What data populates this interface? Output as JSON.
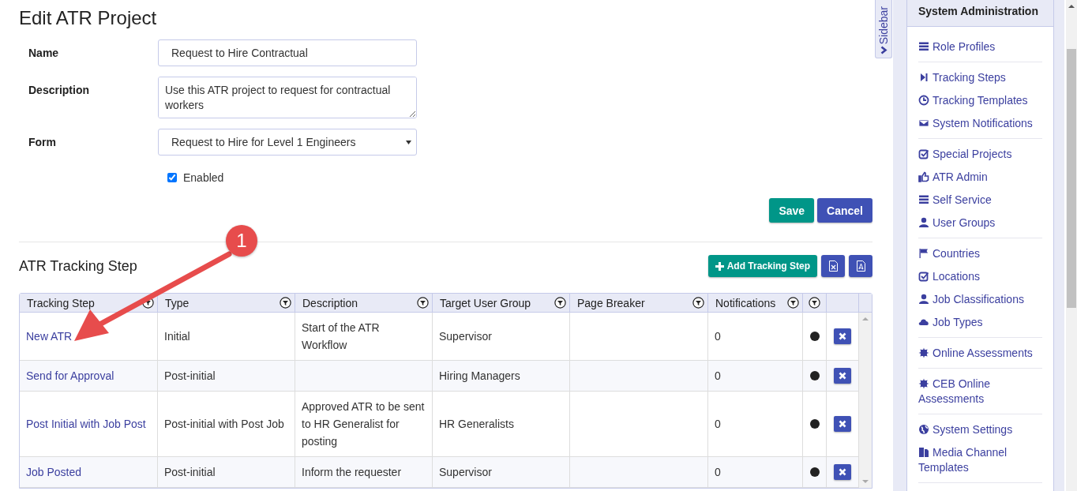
{
  "page": {
    "title": "Edit ATR Project"
  },
  "form": {
    "fields": [
      {
        "kind": "text",
        "label": "Name",
        "value": "Request to Hire Contractual"
      },
      {
        "kind": "textarea",
        "label": "Description",
        "value": "Use this ATR project to request for contractual workers"
      },
      {
        "kind": "select",
        "label": "Form",
        "value": "Request to Hire for Level 1 Engineers"
      }
    ],
    "enabled": {
      "label": "Enabled",
      "checked": true
    },
    "buttons": [
      {
        "label": "Save",
        "kind": "primary"
      },
      {
        "label": "Cancel",
        "kind": "secondary"
      }
    ]
  },
  "tracking": {
    "title": "ATR Tracking Step",
    "add_button": "Add Tracking Step",
    "columns": [
      "Tracking Step",
      "Type",
      "Description",
      "Target User Group",
      "Page Breaker",
      "Notifications"
    ],
    "rows": [
      {
        "step": "New ATR",
        "type": "Initial",
        "description": "Start of the ATR Workflow",
        "target": "Supervisor",
        "notifications": "0"
      },
      {
        "step": "Send for Approval",
        "type": "Post-initial",
        "target": "Hiring Managers",
        "notifications": "0"
      },
      {
        "step": "Post Initial with Job Post",
        "type": "Post-initial with Post Job",
        "description": "Approved ATR to be sent to HR Generalist for posting",
        "target": "HR Generalists",
        "notifications": "0"
      },
      {
        "step": "Job Posted",
        "type": "Post-initial",
        "description": "Inform the requester",
        "target": "Supervisor",
        "notifications": "0"
      }
    ]
  },
  "annotation": {
    "number": "1"
  },
  "sidebar_tab": {
    "label": "Sidebar"
  },
  "sidebar": {
    "title": "System Administration",
    "groups": [
      {
        "items": [
          {
            "label": "Role Profiles",
            "kind": "list"
          }
        ]
      },
      {
        "items": [
          {
            "label": "Tracking Steps",
            "kind": "step"
          },
          {
            "label": "Tracking Templates",
            "kind": "clock"
          },
          {
            "label": "System Notifications",
            "kind": "mail"
          }
        ]
      },
      {
        "items": [
          {
            "label": "Special Projects",
            "kind": "check"
          },
          {
            "label": "ATR Admin",
            "kind": "thumb"
          },
          {
            "label": "Self Service",
            "kind": "list"
          },
          {
            "label": "User Groups",
            "kind": "user"
          }
        ]
      },
      {
        "items": [
          {
            "label": "Countries",
            "kind": "flag"
          },
          {
            "label": "Locations",
            "kind": "check"
          },
          {
            "label": "Job Classifications",
            "kind": "user"
          },
          {
            "label": "Job Types",
            "kind": "cloud"
          }
        ]
      },
      {
        "items": [
          {
            "label": "Online Assessments",
            "kind": "burst"
          }
        ]
      },
      {
        "items": [
          {
            "label": "CEB Online Assessments",
            "kind": "burst"
          }
        ]
      },
      {
        "items": [
          {
            "label": "System Settings",
            "kind": "globe"
          },
          {
            "label": "Media Channel Templates",
            "kind": "file"
          }
        ]
      }
    ]
  }
}
